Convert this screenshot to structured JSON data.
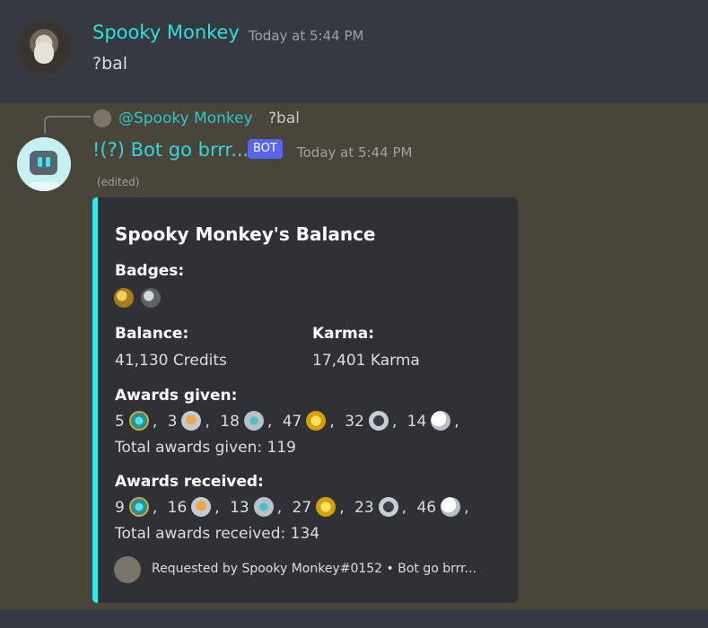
{
  "author": {
    "name": "Spooky Monkey",
    "timestamp": "Today at 5:44 PM",
    "message": "?bal"
  },
  "reply": {
    "mention": "@Spooky Monkey",
    "text": "?bal"
  },
  "bot": {
    "name": "!(?) Bot go brrr...",
    "badge": "BOT",
    "timestamp": "Today at 5:44 PM",
    "edited": "(edited)"
  },
  "embed": {
    "accent": "#1cf3f2",
    "title": "Spooky Monkey's Balance",
    "badges_label": "Badges:",
    "balance_label": "Balance:",
    "balance_value": "41,130 Credits",
    "karma_label": "Karma:",
    "karma_value": "17,401 Karma",
    "awards_given_label": "Awards given:",
    "awards_given": [
      {
        "count": "5",
        "icon": "teal-gem-award-icon"
      },
      {
        "count": "3",
        "icon": "orange-heart-award-icon"
      },
      {
        "count": "18",
        "icon": "silver-shield-award-icon"
      },
      {
        "count": "47",
        "icon": "gold-star-award-icon"
      },
      {
        "count": "32",
        "icon": "silver-coin-s-award-icon"
      },
      {
        "count": "14",
        "icon": "white-face-award-icon"
      }
    ],
    "awards_given_total": "Total awards given: 119",
    "awards_received_label": "Awards received:",
    "awards_received": [
      {
        "count": "9",
        "icon": "teal-gem-award-icon"
      },
      {
        "count": "16",
        "icon": "orange-heart-award-icon"
      },
      {
        "count": "13",
        "icon": "silver-shield-award-icon"
      },
      {
        "count": "27",
        "icon": "gold-star-award-icon"
      },
      {
        "count": "23",
        "icon": "silver-coin-s-award-icon"
      },
      {
        "count": "46",
        "icon": "white-face-award-icon"
      }
    ],
    "awards_received_total": "Total awards received: 134",
    "footer": "Requested by Spooky Monkey#0152 • Bot go brrr..."
  }
}
